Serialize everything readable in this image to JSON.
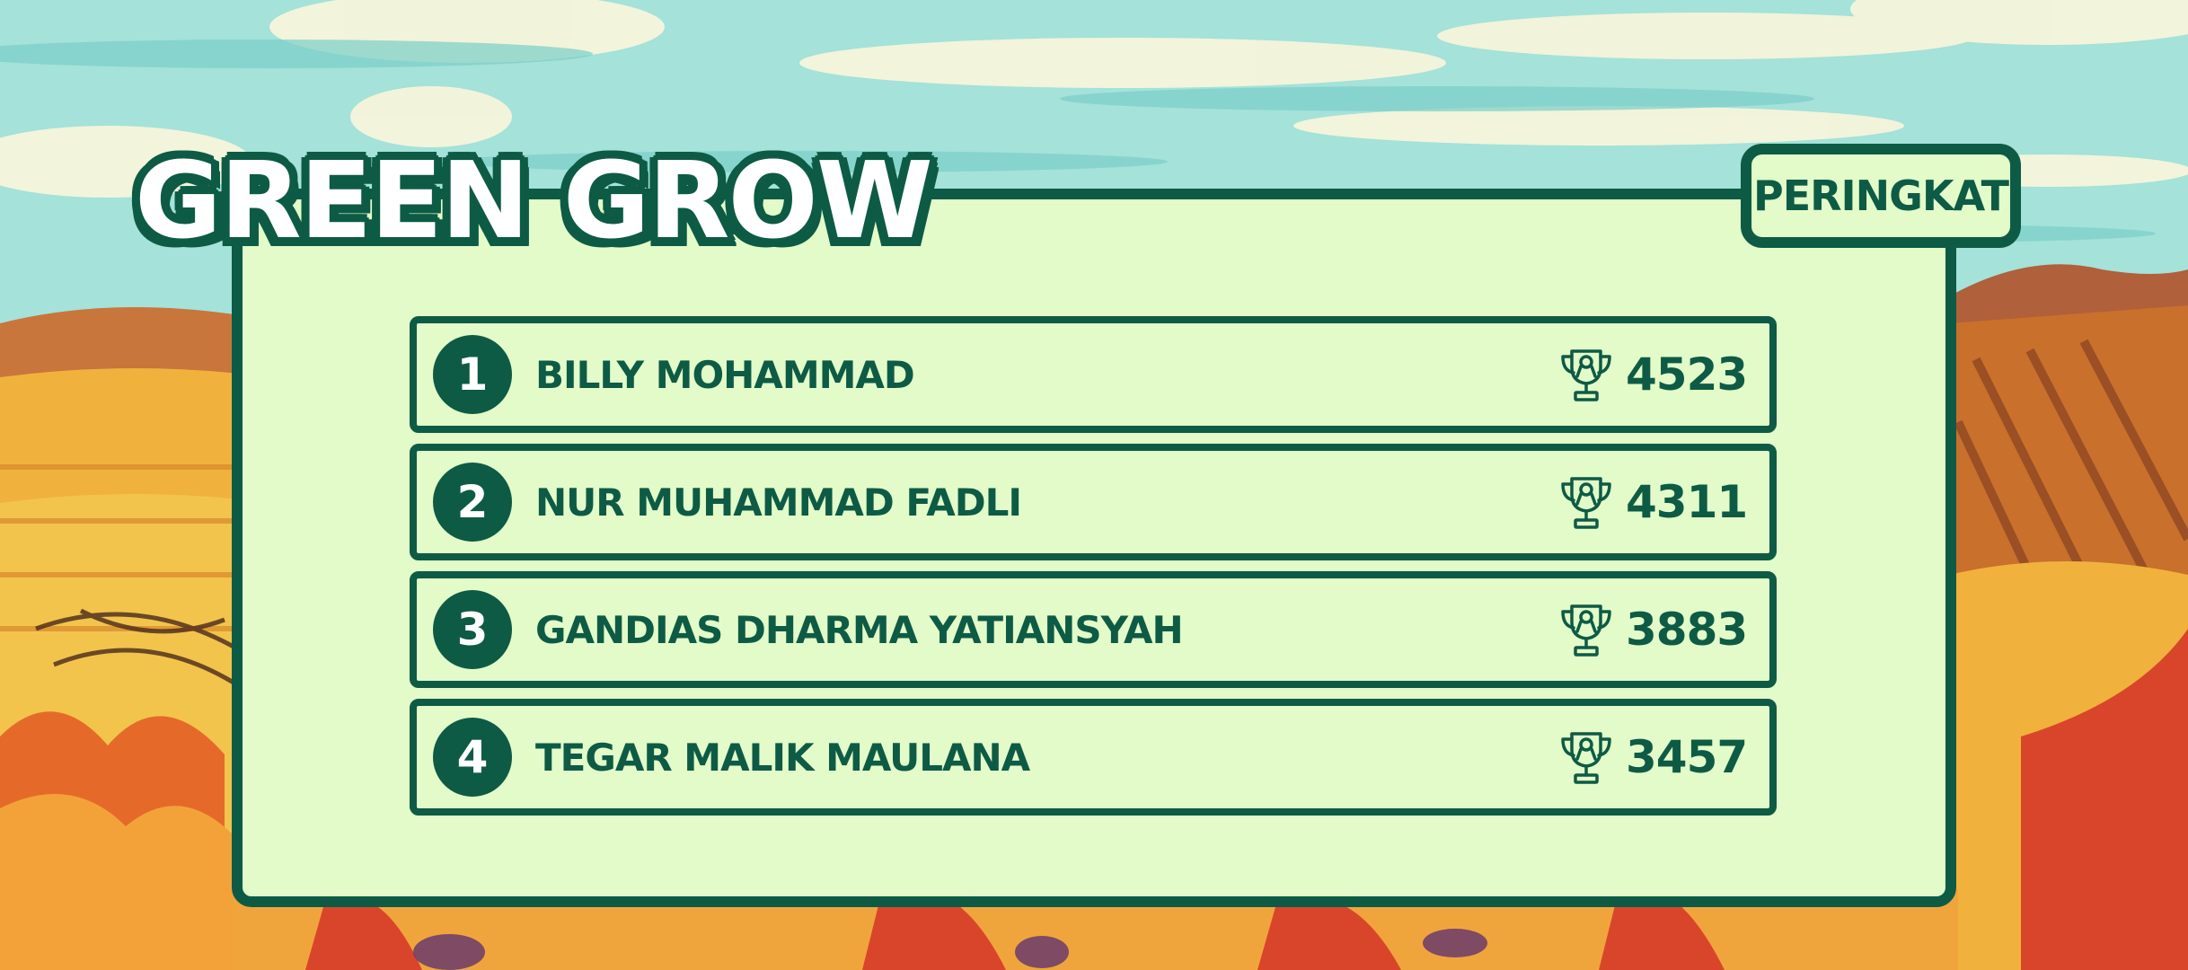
{
  "header": {
    "title": "Green Grow",
    "tab_label": "Peringkat"
  },
  "leaderboard": {
    "rows": [
      {
        "rank": "1",
        "name": "Billy Mohammad",
        "score": "4523",
        "icon": "trophy-icon"
      },
      {
        "rank": "2",
        "name": "Nur Muhammad Fadli",
        "score": "4311",
        "icon": "trophy-icon"
      },
      {
        "rank": "3",
        "name": "Gandias Dharma Yatiansyah",
        "score": "3883",
        "icon": "trophy-icon"
      },
      {
        "rank": "4",
        "name": "Tegar Malik Maulana",
        "score": "3457",
        "icon": "trophy-icon"
      }
    ]
  },
  "colors": {
    "primary_dark": "#0d5b45",
    "panel_fill": "#e3fbc9",
    "title_text": "#ffffff",
    "sky": "#9fe0d9"
  }
}
